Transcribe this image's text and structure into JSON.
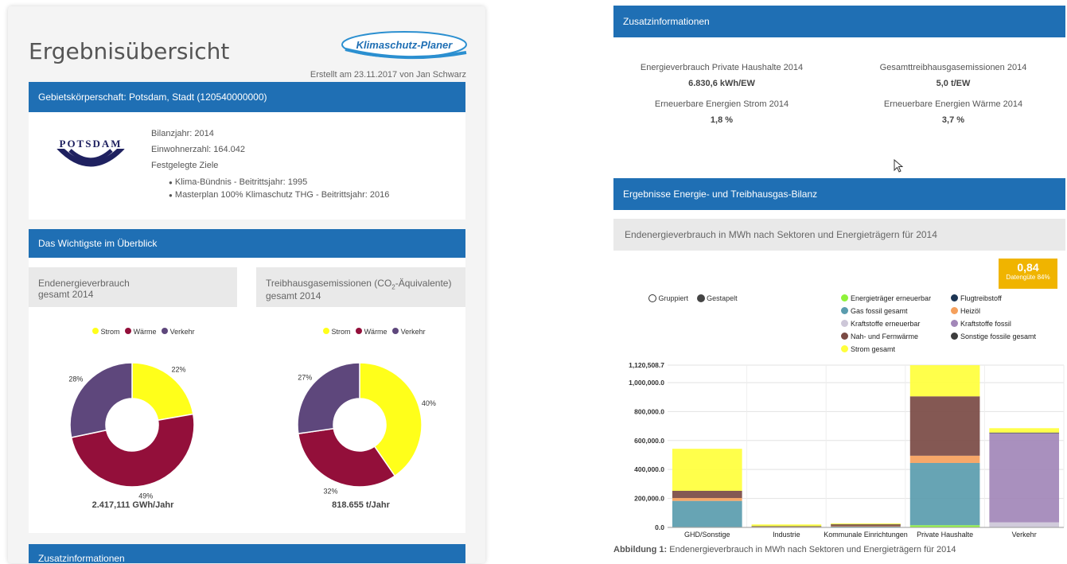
{
  "report": {
    "title": "Ergebnisübersicht",
    "logo_text": "Klimaschutz-Planer",
    "created": "Erstellt am 23.11.2017 von Jan Schwarz"
  },
  "region": {
    "header": "Gebietskörperschaft: Potsdam, Stadt (120540000000)",
    "city_logo_text": "POTSDAM",
    "bilanzjahr": "Bilanzjahr: 2014",
    "einwohner": "Einwohnerzahl: 164.042",
    "goals_label": "Festgelegte Ziele",
    "goals": [
      "Klima-Bündnis - Beitrittsjahr: 1995",
      "Masterplan 100% Klimaschutz THG - Beitrittsjahr: 2016"
    ]
  },
  "overview": {
    "header": "Das Wichtigste im Überblick",
    "energy_card": {
      "line1": "Endenergieverbrauch",
      "line2": "gesamt 2014"
    },
    "ghg_card": {
      "line1_pre": "Treibhausgasemissionen (CO",
      "line1_sub": "2",
      "line1_post": "-Äquivalente)",
      "line2": "gesamt 2014"
    },
    "legend": [
      {
        "label": "Strom",
        "color": "#ffff1a"
      },
      {
        "label": "Wärme",
        "color": "#930f3a"
      },
      {
        "label": "Verkehr",
        "color": "#5e477c"
      }
    ],
    "energy_total": "2.417,111 GWh/Jahr",
    "ghg_total": "818.655 t/Jahr",
    "next_header": "Zusatzinformationen"
  },
  "extra": {
    "header": "Zusatzinformationen",
    "stats": [
      {
        "label": "Energieverbrauch Private Haushalte 2014",
        "value": "6.830,6 kWh/EW"
      },
      {
        "label": "Gesamttreibhausgasemissionen 2014",
        "value": "5,0 t/EW"
      },
      {
        "label": "Erneuerbare Energien Strom 2014",
        "value": "1,8 %"
      },
      {
        "label": "Erneuerbare Energien Wärme 2014",
        "value": "3,7 %"
      }
    ]
  },
  "results": {
    "header": "Ergebnisse Energie- und Treibhausgas-Bilanz",
    "chart_title": "Endenergieverbrauch in MWh nach Sektoren und Energieträgern für 2014",
    "quality_value": "0,84",
    "quality_label": "Datengüte 84%",
    "mode_grouped": "Gruppiert",
    "mode_stacked": "Gestapelt",
    "caption_bold": "Abbildung 1:",
    "caption_text": " Endenergieverbrauch in MWh nach Sektoren und Energieträgern für 2014"
  },
  "chart_data": [
    {
      "type": "pie",
      "title": "Endenergieverbrauch gesamt 2014",
      "categories": [
        "Strom",
        "Wärme",
        "Verkehr"
      ],
      "values": [
        22,
        49,
        28
      ],
      "value_labels": [
        "22%",
        "49%",
        "28%"
      ],
      "colors": [
        "#ffff1a",
        "#930f3a",
        "#5e477c"
      ],
      "donut": true
    },
    {
      "type": "pie",
      "title": "Treibhausgasemissionen (CO2-Äquivalente) gesamt 2014",
      "categories": [
        "Strom",
        "Wärme",
        "Verkehr"
      ],
      "values": [
        40,
        32,
        27
      ],
      "value_labels": [
        "40%",
        "32%",
        "27%"
      ],
      "colors": [
        "#ffff1a",
        "#930f3a",
        "#5e477c"
      ],
      "donut": true
    },
    {
      "type": "bar",
      "stacked": true,
      "title": "Endenergieverbrauch in MWh nach Sektoren und Energieträgern für 2014",
      "categories": [
        "GHD/Sonstige",
        "Industrie",
        "Kommunale Einrichtungen",
        "Private Haushalte",
        "Verkehr"
      ],
      "ylim": [
        0,
        1120508.7
      ],
      "yticks": [
        0,
        200000,
        400000,
        600000,
        800000,
        1000000,
        1120508.7
      ],
      "ytick_labels": [
        "0.0",
        "200,000.0",
        "400,000.0",
        "600,000.0",
        "800,000.0",
        "1,000,000.0",
        "1,120,508.7"
      ],
      "grid": true,
      "legend_position": "top",
      "series": [
        {
          "name": "Energieträger erneuerbar",
          "color": "#8ff23a",
          "values": [
            3000,
            500,
            300,
            15000,
            0
          ]
        },
        {
          "name": "Flugtreibstoff",
          "color": "#1c3554",
          "values": [
            0,
            0,
            0,
            0,
            0
          ]
        },
        {
          "name": "Gas fossil gesamt",
          "color": "#5a9cae",
          "values": [
            180000,
            3000,
            6000,
            430000,
            0
          ]
        },
        {
          "name": "Heizöl",
          "color": "#f5a05c",
          "values": [
            20000,
            1000,
            2000,
            50000,
            0
          ]
        },
        {
          "name": "Kraftstoffe erneuerbar",
          "color": "#cdc7d8",
          "values": [
            0,
            0,
            0,
            0,
            35000
          ]
        },
        {
          "name": "Kraftstoffe fossil",
          "color": "#a287b8",
          "values": [
            0,
            0,
            0,
            0,
            615000
          ]
        },
        {
          "name": "Nah- und Fernwärme",
          "color": "#7a4a44",
          "values": [
            50000,
            3000,
            12000,
            410000,
            0
          ]
        },
        {
          "name": "Sonstige fossile gesamt",
          "color": "#3d3d3d",
          "values": [
            0,
            1000,
            1000,
            0,
            5000
          ]
        },
        {
          "name": "Strom gesamt",
          "color": "#ffff3c",
          "values": [
            290000,
            12000,
            6000,
            215000,
            30000
          ]
        }
      ]
    }
  ]
}
